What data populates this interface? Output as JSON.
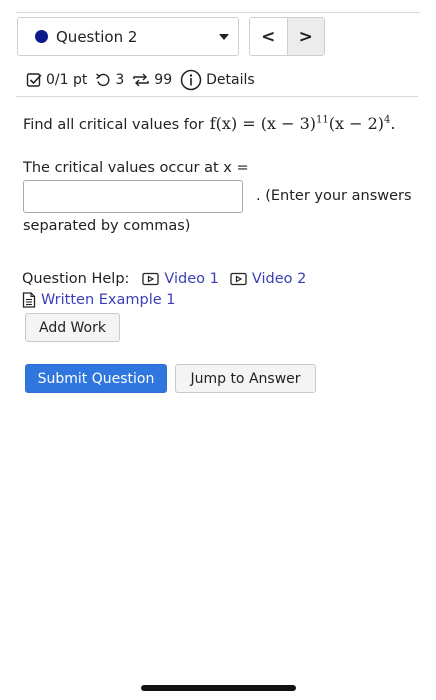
{
  "colors": {
    "status_dot": "#0d1a8a",
    "link": "#3b3fb5",
    "primary_button": "#2f76de"
  },
  "question_nav": {
    "selected": "Question 2",
    "prev_glyph": "<",
    "next_glyph": ">"
  },
  "status": {
    "score": "0/1 pt",
    "retries": "3",
    "attempts": "99",
    "details_label": "Details"
  },
  "question": {
    "prompt": "Find all critical values for",
    "math": {
      "lhs": "f(x) = (x − 3)",
      "exp1": "11",
      "mid": "(x − 2)",
      "exp2": "4",
      "end": "."
    },
    "answer_lead": "The critical values occur at x =",
    "answer_value": "",
    "answer_note_1": ". (Enter your answers",
    "answer_note_2": "separated by commas)"
  },
  "help": {
    "label": "Question Help:",
    "video1": "Video 1",
    "video2": "Video 2",
    "example": "Written Example 1"
  },
  "buttons": {
    "add_work": "Add Work",
    "submit": "Submit Question",
    "jump": "Jump to Answer"
  }
}
